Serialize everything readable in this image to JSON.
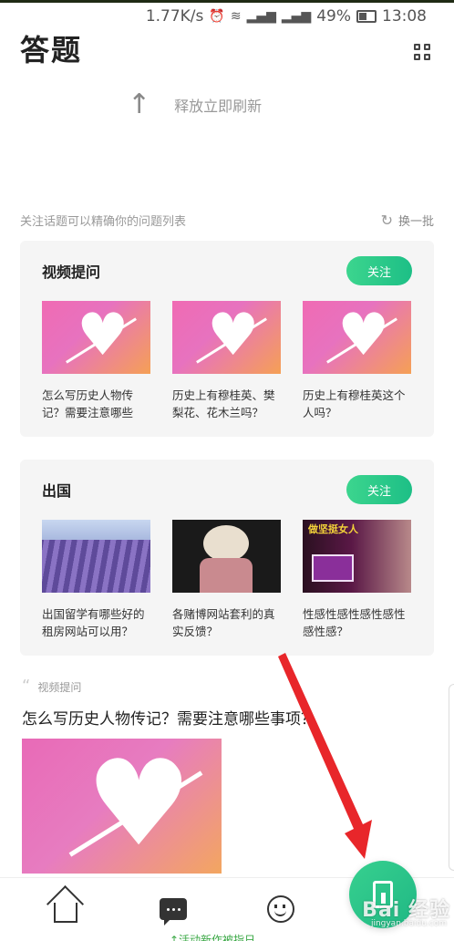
{
  "status_bar": {
    "speed": "1.77K/s",
    "battery": "49%",
    "time": "13:08",
    "icons": [
      "alarm-icon",
      "wifi-icon",
      "signal-3g-icon",
      "signal-4g-icon",
      "battery-icon"
    ]
  },
  "header": {
    "title": "答题",
    "menu_icon": "grid-icon"
  },
  "pull_refresh": {
    "text": "释放立即刷新"
  },
  "hint": {
    "text": "关注话题可以精确你的问题列表",
    "switch_label": "换一批"
  },
  "topic_cards": [
    {
      "title": "视频提问",
      "follow_label": "关注",
      "items": [
        {
          "caption": "怎么写历史人物传记？需要注意哪些",
          "image": "heart-arrow"
        },
        {
          "caption": "历史上有穆桂英、樊梨花、花木兰吗？",
          "image": "heart-arrow"
        },
        {
          "caption": "历史上有穆桂英这个人吗？",
          "image": "heart-arrow"
        }
      ]
    },
    {
      "title": "出国",
      "follow_label": "关注",
      "items": [
        {
          "caption": "出国留学有哪些好的租房网站可以用？",
          "image": "lavender-field"
        },
        {
          "caption": "各赌博网站套利的真实反馈？",
          "image": "doll"
        },
        {
          "caption": "性感性感性感性感性感性感？",
          "image": "ad-banner",
          "ad_text": "做坚挺女人"
        }
      ]
    }
  ],
  "feed": {
    "tag": "视频提问",
    "title": "怎么写历史人物传记？需要注意哪些事项？"
  },
  "tab_bar": {
    "tabs": [
      "home-icon",
      "chat-icon",
      "smiley-icon"
    ],
    "fab_icon": "answer-pen-icon"
  },
  "watermark": {
    "text": "Bai 经验",
    "sub": "jingyan.baidu.com"
  },
  "bottom_peek": "↑活动新作被指日",
  "colors": {
    "accent": "#2ccb8a",
    "annotation_arrow": "#e8262a"
  }
}
